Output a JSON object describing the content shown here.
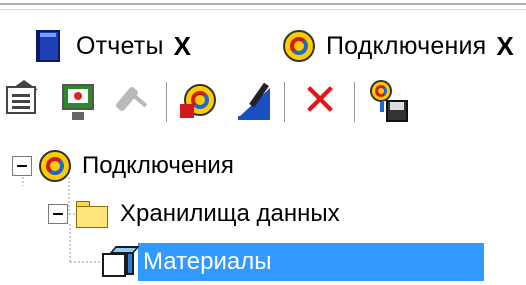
{
  "tabs": [
    {
      "label": "Отчеты",
      "close": "X",
      "icon": "report-book-icon"
    },
    {
      "label": "Подключения",
      "close": "X",
      "icon": "connection-icon"
    }
  ],
  "toolbar": {
    "buttons": [
      {
        "icon": "properties-icon"
      },
      {
        "icon": "monitor-icon"
      },
      {
        "icon": "plug-icon",
        "disabled": true
      },
      {
        "icon": "new-connection-icon"
      },
      {
        "icon": "edit-icon"
      },
      {
        "icon": "delete-icon",
        "glyph": "✕"
      },
      {
        "icon": "save-connection-icon"
      }
    ]
  },
  "tree": {
    "root": {
      "label": "Подключения",
      "icon": "connection-icon",
      "expander": "-"
    },
    "folder": {
      "label": "Хранилища данных",
      "icon": "folder-icon",
      "expander": "-"
    },
    "leaf": {
      "label": "Материалы",
      "icon": "cube-icon",
      "selected": true
    }
  },
  "colors": {
    "selection": "#3199ff",
    "delete": "#e01818",
    "connection_ring": "#ffcc00"
  }
}
